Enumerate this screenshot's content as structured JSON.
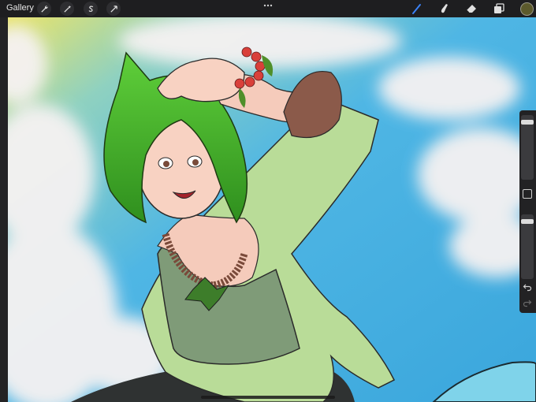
{
  "topbar": {
    "gallery_label": "Gallery",
    "left_tools": [
      "wrench-icon",
      "magic-wand-icon",
      "selection-s-icon",
      "transform-arrow-icon"
    ],
    "right_tools": [
      "brush-icon",
      "smudge-icon",
      "eraser-icon",
      "layers-icon"
    ],
    "active_tool": "brush-icon",
    "current_color": "#5c5a2c",
    "accent_color": "#3b82f6"
  },
  "sidebar": {
    "brush_size_level": 0.1,
    "opacity_level": 0.1
  }
}
